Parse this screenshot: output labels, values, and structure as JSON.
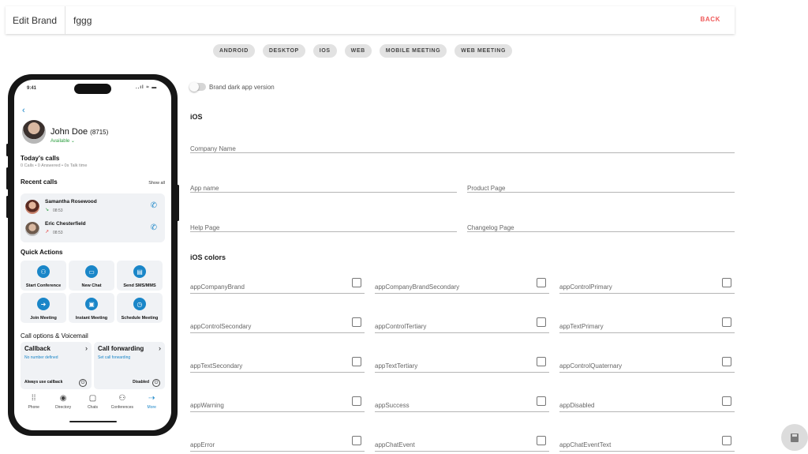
{
  "header": {
    "title": "Edit Brand",
    "brand_name": "fggg",
    "back_label": "BACK"
  },
  "tabs": [
    "ANDROID",
    "DESKTOP",
    "IOS",
    "WEB",
    "MOBILE MEETING",
    "WEB MEETING"
  ],
  "phone": {
    "time": "9:41",
    "status_icons": "..ıl ≈ ▬",
    "user_name": "John Doe",
    "user_ext": "(8715)",
    "user_status": "Available ⌄",
    "todays_calls_title": "Today's calls",
    "todays_calls_sub": "0 Calls • 0 Answered • 0s Talk time",
    "recent_calls_title": "Recent calls",
    "show_all": "Show all",
    "recent_calls": [
      {
        "name": "Samantha Rosewood",
        "time": "08:53",
        "dir": "↘",
        "dir_color": "#2b9e3f"
      },
      {
        "name": "Eric Chesterfield",
        "time": "08:53",
        "dir": "↗",
        "dir_color": "#e53935"
      }
    ],
    "quick_actions_title": "Quick Actions",
    "quick_actions": [
      {
        "label": "Start Conference",
        "icon": "conference-icon",
        "glyph": "⚇"
      },
      {
        "label": "New Chat",
        "icon": "chat-icon",
        "glyph": "▭"
      },
      {
        "label": "Send SMS/MMS",
        "icon": "sms-icon",
        "glyph": "▤"
      },
      {
        "label": "Join Meeting",
        "icon": "join-icon",
        "glyph": "➜"
      },
      {
        "label": "Instant Meeting",
        "icon": "video-icon",
        "glyph": "▣"
      },
      {
        "label": "Schedule Meeting",
        "icon": "clock-icon",
        "glyph": "◷"
      }
    ],
    "call_options_title": "Call options & Voicemail",
    "callback": {
      "title": "Callback",
      "sub": "No number defined",
      "foot": "Always use callback"
    },
    "forwarding": {
      "title": "Call forwarding",
      "sub": "Set call forwarding",
      "foot": "Disabled"
    },
    "nav": [
      {
        "label": "Phone",
        "glyph": "⁞⁞"
      },
      {
        "label": "Directory",
        "glyph": "◉"
      },
      {
        "label": "Chats",
        "glyph": "▢"
      },
      {
        "label": "Conferences",
        "glyph": "⚇"
      },
      {
        "label": "More",
        "glyph": "⇢"
      }
    ]
  },
  "form": {
    "dark_toggle_label": "Brand dark app version",
    "ios_title": "iOS",
    "company_name": "Company Name",
    "app_name": "App name",
    "product_page": "Product Page",
    "help_page": "Help Page",
    "changelog_page": "Changelog Page",
    "colors_title": "iOS colors",
    "colors": [
      "appCompanyBrand",
      "appCompanyBrandSecondary",
      "appControlPrimary",
      "appControlSecondary",
      "appControlTertiary",
      "appTextPrimary",
      "appTextSecondary",
      "appTextTertiary",
      "appControlQuaternary",
      "appWarning",
      "appSuccess",
      "appDisabled",
      "appError",
      "appChatEvent",
      "appChatEventText"
    ]
  }
}
